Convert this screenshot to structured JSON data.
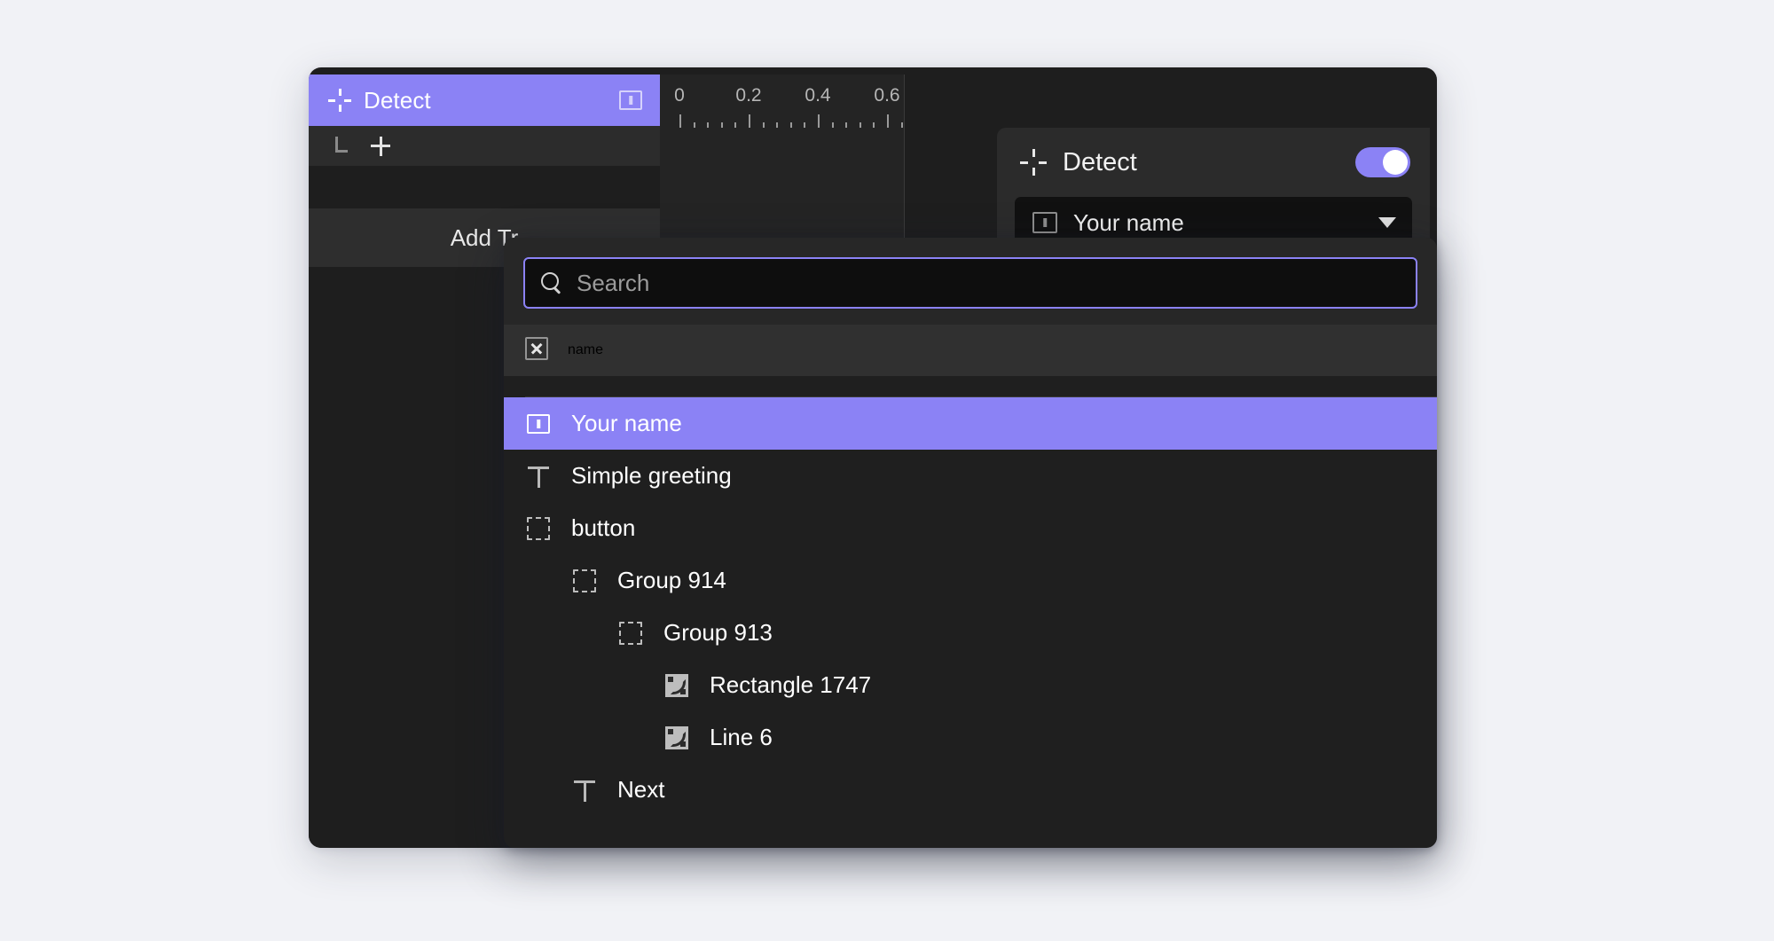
{
  "theme": {
    "accent": "#8b82f5",
    "page_background": "#f1f2f6",
    "window_background": "#1e1e1e",
    "panel_background": "#2b2b2b",
    "dropdown_background": "#1f1f1f"
  },
  "timeline": {
    "track": {
      "title": "Detect",
      "title_icon": "crosshair-detect-icon",
      "type_icon": "input-field-icon",
      "child_connector_icon": "corner-connector-icon",
      "add_keyframe_icon": "plus-icon"
    },
    "add_track_label": "Add Tr",
    "ruler": {
      "tick_labels": [
        "0",
        "0.2",
        "0.4",
        "0.6"
      ],
      "tick_values": [
        0,
        0.2,
        0.4,
        0.6
      ],
      "minor_ticks_per_major": 5
    }
  },
  "inspector": {
    "title": "Detect",
    "title_icon": "crosshair-detect-icon",
    "toggle": {
      "state": "on",
      "icon": "toggle-switch-icon"
    },
    "target_select": {
      "value": "Your name",
      "icon": "input-field-icon",
      "caret_icon": "chevron-down-icon"
    }
  },
  "dropdown": {
    "search": {
      "placeholder": "Search",
      "value": "",
      "icon": "search-icon",
      "focused": true
    },
    "current": {
      "label": "name",
      "icon": "x-box-icon",
      "indent": 0
    },
    "items": [
      {
        "label": "Your name",
        "icon": "input-field-icon",
        "indent": 0,
        "selected": true
      },
      {
        "label": "Simple greeting",
        "icon": "text-icon",
        "indent": 0,
        "selected": false
      },
      {
        "label": "button",
        "icon": "frame-icon",
        "indent": 0,
        "selected": false
      },
      {
        "label": "Group 914",
        "icon": "frame-icon",
        "indent": 1,
        "selected": false
      },
      {
        "label": "Group 913",
        "icon": "frame-icon",
        "indent": 2,
        "selected": false
      },
      {
        "label": "Rectangle 1747",
        "icon": "vector-icon",
        "indent": 3,
        "selected": false
      },
      {
        "label": "Line 6",
        "icon": "vector-icon",
        "indent": 3,
        "selected": false
      },
      {
        "label": "Next",
        "icon": "text-icon",
        "indent": 1,
        "selected": false
      }
    ]
  }
}
